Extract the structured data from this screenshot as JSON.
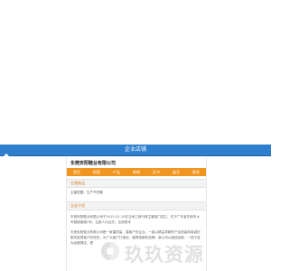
{
  "header": {
    "title": "企业店铺",
    "home_icon": "home-icon",
    "bar_color": "#2f7fcf"
  },
  "company": {
    "name": "东莞安阳鞋业有限公司"
  },
  "nav": {
    "color": "#f0951f",
    "items": [
      {
        "label": "首页"
      },
      {
        "label": "档案"
      },
      {
        "label": "产品"
      },
      {
        "label": "新闻"
      },
      {
        "label": "证书"
      },
      {
        "label": "留言"
      },
      {
        "label": "联系"
      }
    ]
  },
  "sections": {
    "main_products": {
      "heading": "主营商品",
      "line": "主营范围：生产不在鞋"
    },
    "intro": {
      "heading": "企业介绍",
      "para1": "东莞安阳鞋业有限公司于2015-01-15在当地工商行政主管部门成立。位于广东省东莞市大岭镇镇南路2号，注册人为吉先，注册资本",
      "para2": "东莞安阳鞋业有限公司是一家重质量、重客户的企业。一直以精益求精的产品质量和真诚的服务赢得客户的信任，为广大客户打造优，值得信赖的品牌。我公司以诚信经营，一诺千金为经营理念，把"
    }
  },
  "watermark": {
    "text": "玖玖资源",
    "icon": "logo-icon"
  }
}
